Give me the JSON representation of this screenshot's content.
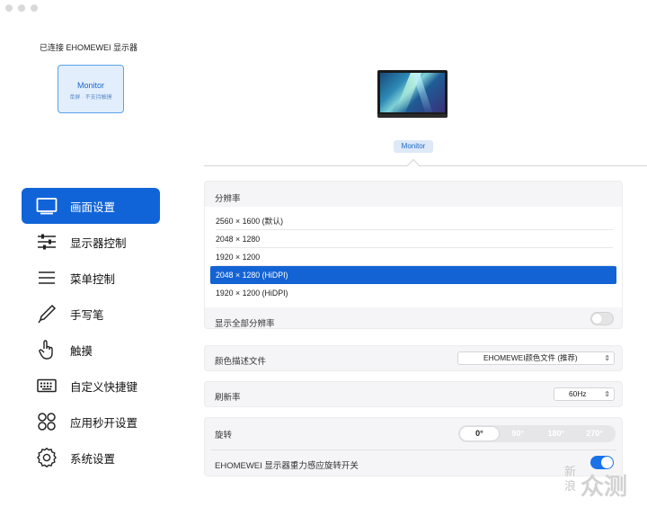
{
  "header": {
    "connected_label": "已连接 EHOMEWEI 显示器"
  },
  "monitor_card": {
    "name": "Monitor",
    "subtitle": "单屏 · 不支持触摸"
  },
  "preview": {
    "tab_label": "Monitor"
  },
  "sidebar": {
    "items": [
      {
        "label": "画面设置",
        "icon": "display-icon",
        "active": true
      },
      {
        "label": "显示器控制",
        "icon": "sliders-icon",
        "active": false
      },
      {
        "label": "菜单控制",
        "icon": "menu-lines-icon",
        "active": false
      },
      {
        "label": "手写笔",
        "icon": "pen-icon",
        "active": false
      },
      {
        "label": "触摸",
        "icon": "touch-hand-icon",
        "active": false
      },
      {
        "label": "自定义快捷键",
        "icon": "keyboard-icon",
        "active": false
      },
      {
        "label": "应用秒开设置",
        "icon": "apps-grid-icon",
        "active": false
      },
      {
        "label": "系统设置",
        "icon": "gear-icon",
        "active": false
      }
    ]
  },
  "resolution": {
    "title": "分辨率",
    "options": [
      "2560 × 1600 (默认)",
      "2048 × 1280",
      "1920 × 1200",
      "2048 × 1280 (HiDPI)",
      "1920 × 1200 (HiDPI)"
    ],
    "selected_index": 3,
    "show_all_label": "显示全部分辨率",
    "show_all_enabled": false
  },
  "color_profile": {
    "title": "颜色描述文件",
    "value": "EHOMEWEI颜色文件 (推荐)"
  },
  "refresh_rate": {
    "title": "刷新率",
    "value": "60Hz"
  },
  "rotation": {
    "title": "旋转",
    "options": [
      "0°",
      "90°",
      "180°",
      "270°"
    ],
    "selected_index": 0,
    "gravity_label": "EHOMEWEI 显示器重力感应旋转开关",
    "gravity_enabled": true
  },
  "watermark": {
    "small": "新浪",
    "big": "众测"
  },
  "colors": {
    "accent": "#1164d8",
    "card_border": "#5aa3e6",
    "card_bg": "#e2eefc",
    "panel_bg": "#f5f5f7"
  }
}
